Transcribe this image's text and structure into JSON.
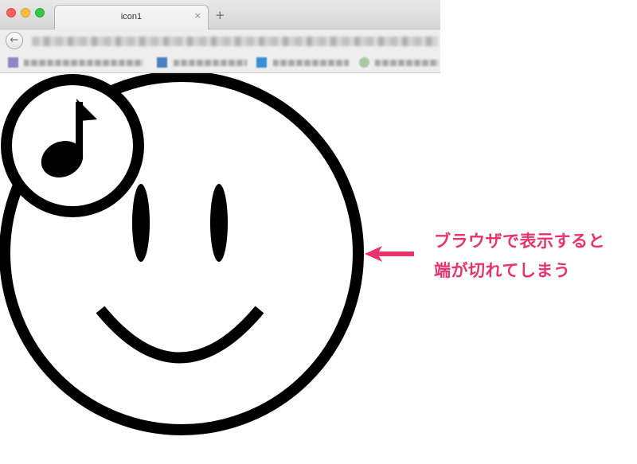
{
  "browser": {
    "tab_title": "icon1",
    "tab_close_glyph": "×",
    "new_tab_glyph": "+",
    "back_glyph": "←"
  },
  "page": {
    "content": "smiley-face-with-music-note-badge",
    "clipped": true
  },
  "annotation": {
    "line1": "ブラウザで表示すると",
    "line2": "端が切れてしまう",
    "color": "#e8336d"
  },
  "colors": {
    "annotation_pink": "#e8336d",
    "traffic_red": "#fc605c",
    "traffic_yellow": "#fdbc40",
    "traffic_green": "#34c84a"
  }
}
